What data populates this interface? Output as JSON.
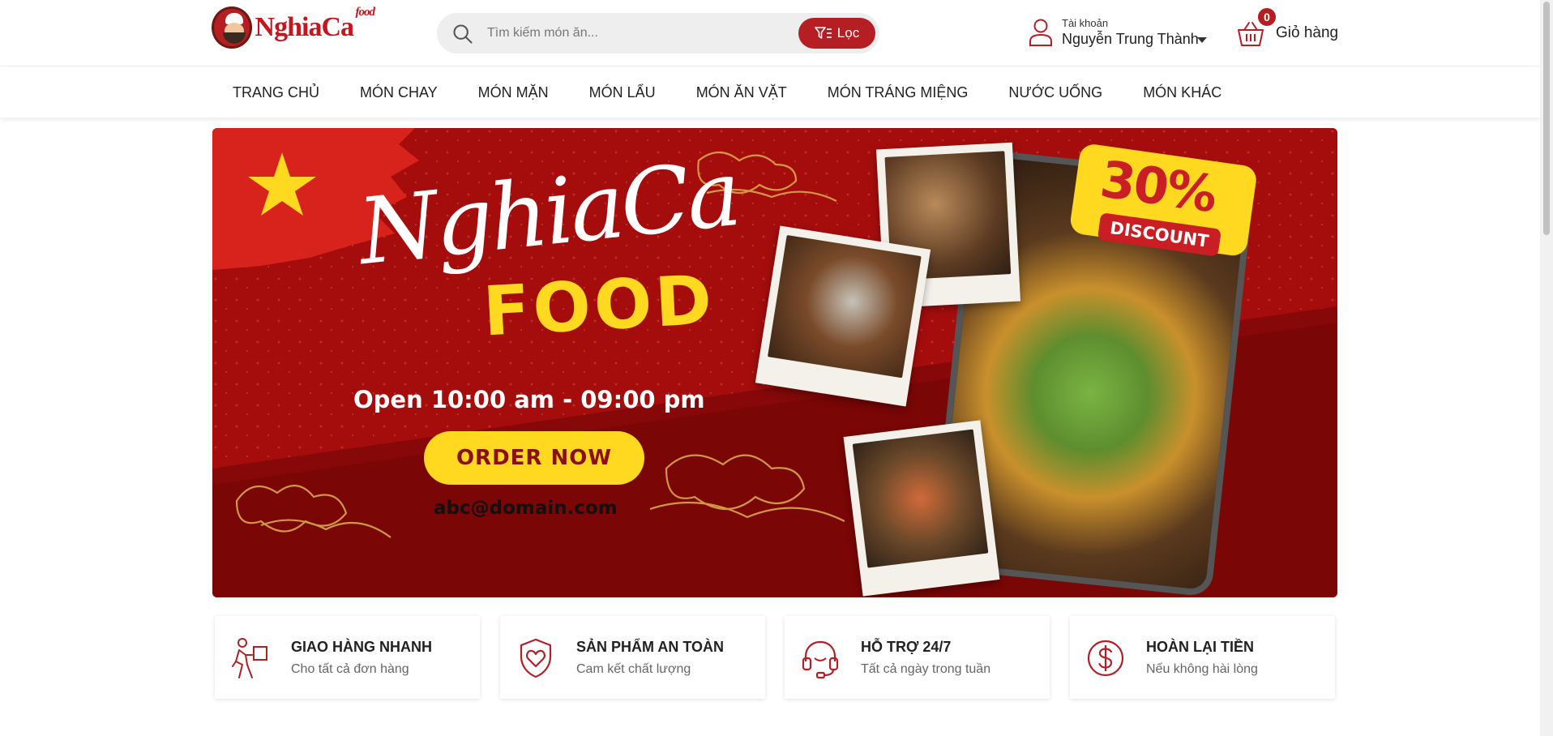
{
  "header": {
    "logo_text": "NghiaCa",
    "logo_sup": "food",
    "search": {
      "placeholder": "Tìm kiếm món ăn..."
    },
    "filter_label": "Lọc",
    "account": {
      "label": "Tài khoản",
      "name": "Nguyễn Trung Thành"
    },
    "cart": {
      "count": "0",
      "label": "Giỏ hàng"
    }
  },
  "nav": {
    "items": [
      {
        "label": "TRANG CHỦ"
      },
      {
        "label": "MÓN CHAY"
      },
      {
        "label": "MÓN MẶN"
      },
      {
        "label": "MÓN LẨU"
      },
      {
        "label": "MÓN ĂN VẶT"
      },
      {
        "label": "MÓN TRÁNG MIỆNG"
      },
      {
        "label": "NƯỚC UỐNG"
      },
      {
        "label": "MÓN KHÁC"
      }
    ]
  },
  "banner": {
    "script_title": "NghiaCa",
    "food_word": "FOOD",
    "hours": "Open 10:00 am - 09:00 pm",
    "order_label": "ORDER NOW",
    "email": "abc@domain.com",
    "discount_pct": "30%",
    "discount_label": "DISCOUNT"
  },
  "features": [
    {
      "title": "GIAO HÀNG NHANH",
      "subtitle": "Cho tất cả đơn hàng",
      "icon": "delivery-icon"
    },
    {
      "title": "SẢN PHẨM AN TOÀN",
      "subtitle": "Cam kết chất lượng",
      "icon": "shield-heart-icon"
    },
    {
      "title": "HỖ TRỢ 24/7",
      "subtitle": "Tất cả ngày trong tuần",
      "icon": "headset-icon"
    },
    {
      "title": "HOÀN LẠI TIỀN",
      "subtitle": "Nếu không hài lòng",
      "icon": "dollar-icon"
    }
  ],
  "colors": {
    "brand_red": "#b51f24",
    "banner_red": "#a50d0d",
    "accent_yellow": "#ffd820"
  }
}
